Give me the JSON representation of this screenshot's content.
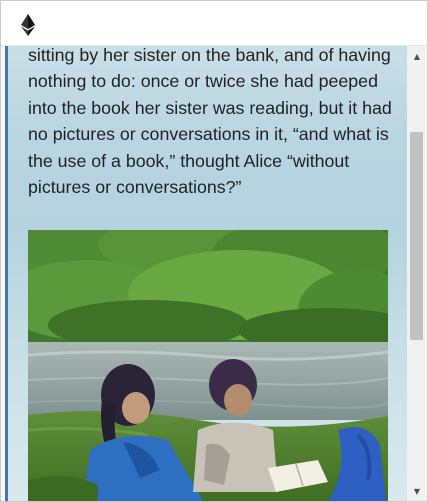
{
  "app": {
    "icon": "ethereum-icon"
  },
  "story": {
    "paragraph": "sitting by her sister on the bank, and of having nothing to do: once or twice she had peeped into the book her sister was reading, but it had no pictures or conversations in it, “and what is the use of a book,” thought Alice “without pictures or conversations?”"
  },
  "illustration": {
    "subject": "two children reading a book on a riverbank"
  },
  "scrollbar": {
    "up_glyph": "▲",
    "down_glyph": "▼",
    "position_fraction": 0.16,
    "visible_fraction": 0.5
  },
  "colors": {
    "accent_border": "#4a77a8",
    "text": "#222222"
  }
}
